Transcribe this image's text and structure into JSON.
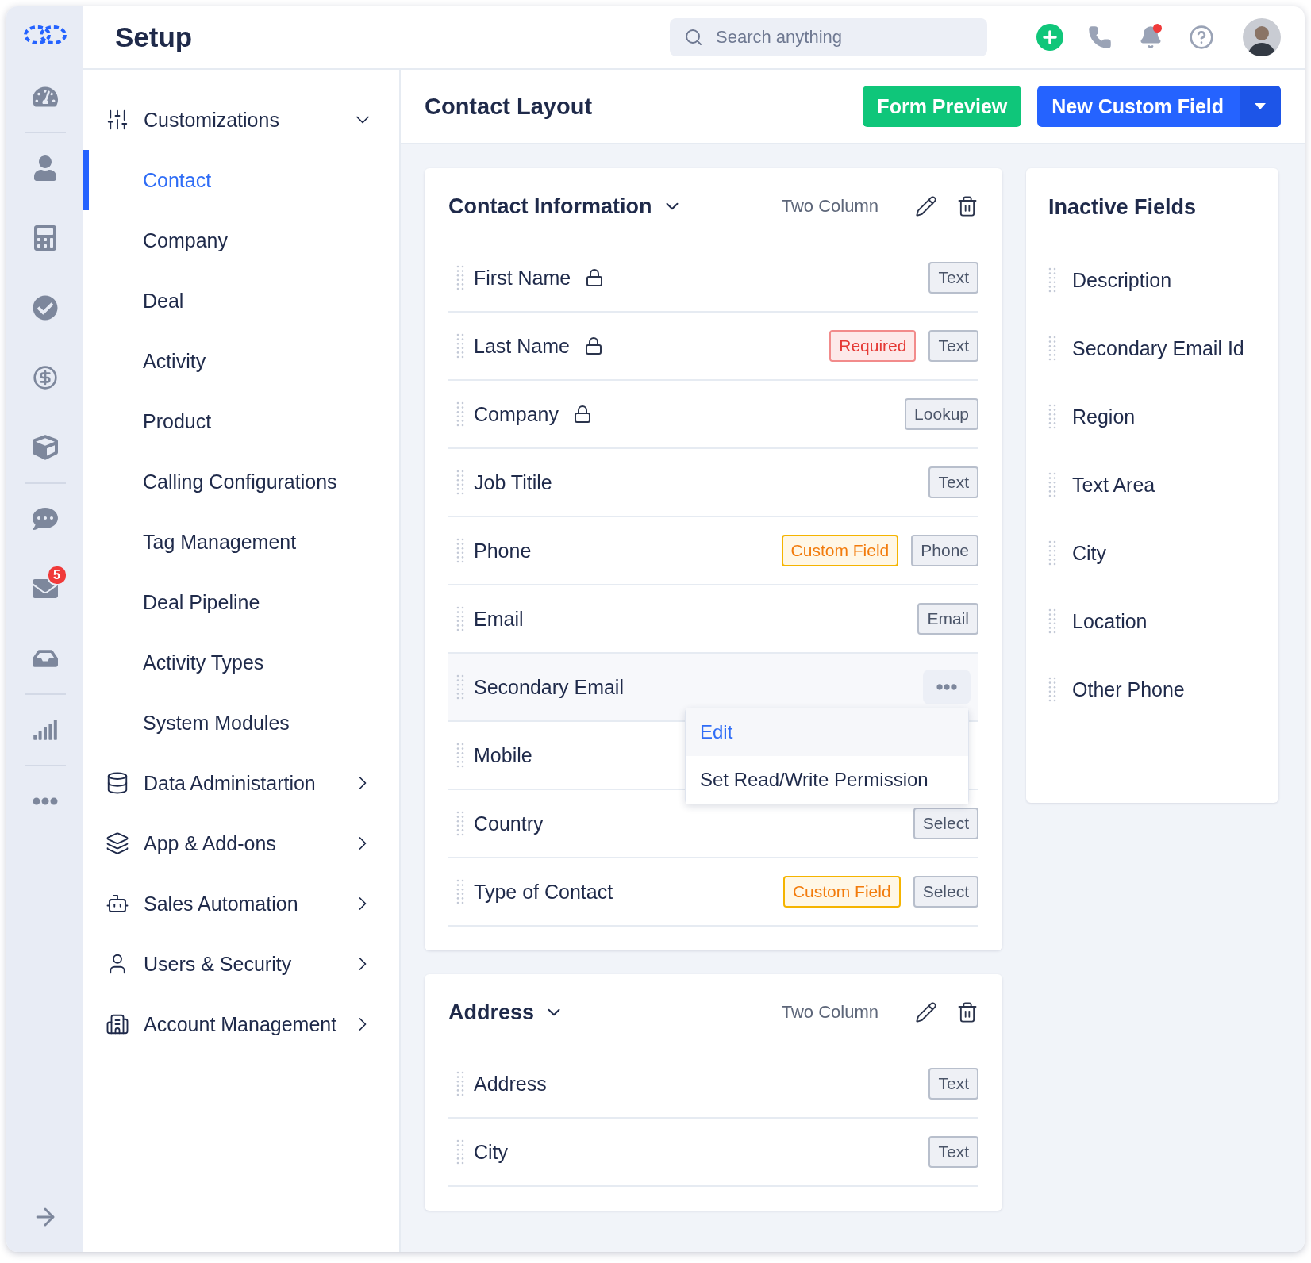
{
  "app": {
    "title": "Setup"
  },
  "rail": {
    "mail_badge": "5"
  },
  "search": {
    "placeholder": "Search anything"
  },
  "notifications": {
    "unread": true
  },
  "sidebar": {
    "groups": [
      {
        "label": "Customizations",
        "expanded": true,
        "children": [
          {
            "label": "Contact",
            "selected": true
          },
          {
            "label": "Company",
            "selected": false
          },
          {
            "label": "Deal",
            "selected": false
          },
          {
            "label": "Activity",
            "selected": false
          },
          {
            "label": "Product",
            "selected": false
          },
          {
            "label": "Calling Configurations",
            "selected": false
          },
          {
            "label": "Tag Management",
            "selected": false
          },
          {
            "label": "Deal Pipeline",
            "selected": false
          },
          {
            "label": "Activity Types",
            "selected": false
          },
          {
            "label": "System Modules",
            "selected": false
          }
        ]
      },
      {
        "label": "Data Administartion",
        "expanded": false
      },
      {
        "label": "App & Add-ons",
        "expanded": false
      },
      {
        "label": "Sales Automation",
        "expanded": false
      },
      {
        "label": "Users & Security",
        "expanded": false
      },
      {
        "label": "Account Management",
        "expanded": false
      }
    ]
  },
  "header": {
    "title": "Contact Layout",
    "buttons": [
      {
        "label": "Form Preview",
        "kind": "secondary"
      },
      {
        "label": "New Custom Field",
        "kind": "primary"
      }
    ]
  },
  "sections": [
    {
      "title": "Contact Information",
      "layout": "Two Column",
      "expanded": true,
      "fields": [
        {
          "name": "First Name",
          "locked": true,
          "tags": [
            {
              "text": "Text",
              "kind": "type"
            }
          ]
        },
        {
          "name": "Last Name",
          "locked": true,
          "tags": [
            {
              "text": "Required",
              "kind": "required"
            },
            {
              "text": "Text",
              "kind": "type"
            }
          ]
        },
        {
          "name": "Company",
          "locked": true,
          "tags": [
            {
              "text": "Lookup",
              "kind": "type"
            }
          ]
        },
        {
          "name": "Job Titile",
          "locked": false,
          "tags": [
            {
              "text": "Text",
              "kind": "type"
            }
          ]
        },
        {
          "name": "Phone",
          "locked": false,
          "tags": [
            {
              "text": "Custom Field",
              "kind": "custom"
            },
            {
              "text": "Phone",
              "kind": "type"
            }
          ]
        },
        {
          "name": "Email",
          "locked": false,
          "tags": [
            {
              "text": "Email",
              "kind": "type"
            }
          ]
        },
        {
          "name": "Secondary Email",
          "locked": false,
          "hovered": true,
          "menu": {
            "items": [
              {
                "label": "Edit",
                "selected": true
              },
              {
                "label": "Set Read/Write Permission",
                "selected": false
              }
            ]
          }
        },
        {
          "name": "Mobile",
          "locked": false
        },
        {
          "name": "Country",
          "locked": false,
          "tags": [
            {
              "text": "Select",
              "kind": "type"
            }
          ]
        },
        {
          "name": "Type of Contact",
          "locked": false,
          "tags": [
            {
              "text": "Custom Field",
              "kind": "custom"
            },
            {
              "text": "Select",
              "kind": "type"
            }
          ]
        }
      ]
    },
    {
      "title": "Address",
      "layout": "Two Column",
      "expanded": true,
      "fields": [
        {
          "name": "Address",
          "locked": false,
          "tags": [
            {
              "text": "Text",
              "kind": "type"
            }
          ]
        },
        {
          "name": "City",
          "locked": false,
          "tags": [
            {
              "text": "Text",
              "kind": "type"
            }
          ]
        }
      ]
    }
  ],
  "inactive": {
    "title": "Inactive Fields",
    "fields": [
      "Description",
      "Secondary Email Id",
      "Region",
      "Text Area",
      "City",
      "Location",
      "Other Phone"
    ]
  }
}
